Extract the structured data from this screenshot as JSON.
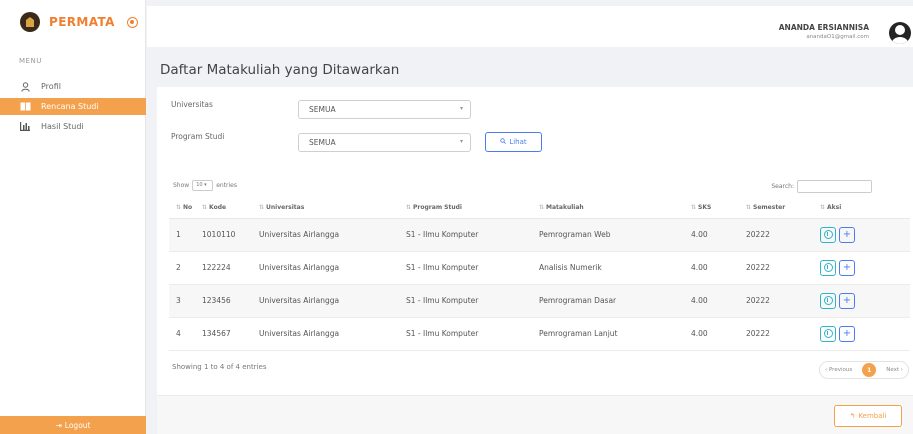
{
  "app": {
    "name": "PERMATA"
  },
  "sidebar": {
    "menu_title": "MENU",
    "items": [
      {
        "label": "Profil",
        "icon": "user-icon",
        "active": false
      },
      {
        "label": "Rencana Studi",
        "icon": "book-icon",
        "active": true
      },
      {
        "label": "Hasil Studi",
        "icon": "bar-chart-icon",
        "active": false
      }
    ],
    "logout_label": "Logout"
  },
  "header": {
    "user_name": "ANANDA ERSIANNISA",
    "user_email": "anandaO1@gmail.com"
  },
  "page": {
    "title": "Daftar Matakuliah yang Ditawarkan"
  },
  "filters": {
    "universitas_label": "Universitas",
    "universitas_value": "SEMUA",
    "prodi_label": "Program Studi",
    "prodi_value": "SEMUA",
    "lihat_label": "Lihat"
  },
  "table_controls": {
    "show_label": "Show",
    "entries_value": "10",
    "entries_label": "entries",
    "search_label": "Search:"
  },
  "table": {
    "headers": [
      "No",
      "Kode",
      "Universitas",
      "Program Studi",
      "Matakuliah",
      "SKS",
      "Semester",
      "Aksi"
    ],
    "rows": [
      {
        "no": "1",
        "kode": "1010110",
        "universitas": "Universitas Airlangga",
        "prodi": "S1 - Ilmu Komputer",
        "matakuliah": "Pemrograman Web",
        "sks": "4.00",
        "semester": "20222"
      },
      {
        "no": "2",
        "kode": "122224",
        "universitas": "Universitas Airlangga",
        "prodi": "S1 - Ilmu Komputer",
        "matakuliah": "Analisis Numerik",
        "sks": "4.00",
        "semester": "20222"
      },
      {
        "no": "3",
        "kode": "123456",
        "universitas": "Universitas Airlangga",
        "prodi": "S1 - Ilmu Komputer",
        "matakuliah": "Pemrograman Dasar",
        "sks": "4.00",
        "semester": "20222"
      },
      {
        "no": "4",
        "kode": "134567",
        "universitas": "Universitas Airlangga",
        "prodi": "S1 - Ilmu Komputer",
        "matakuliah": "Pemrograman Lanjut",
        "sks": "4.00",
        "semester": "20222"
      }
    ]
  },
  "footer": {
    "showing": "Showing 1 to 4 of 4 entries",
    "previous": "Previous",
    "page": "1",
    "next": "Next",
    "kembali": "Kembali"
  },
  "colors": {
    "accent": "#f4a14d",
    "brand": "#f07f2f",
    "primary": "#4d7cf2",
    "info": "#2fb5c9"
  }
}
